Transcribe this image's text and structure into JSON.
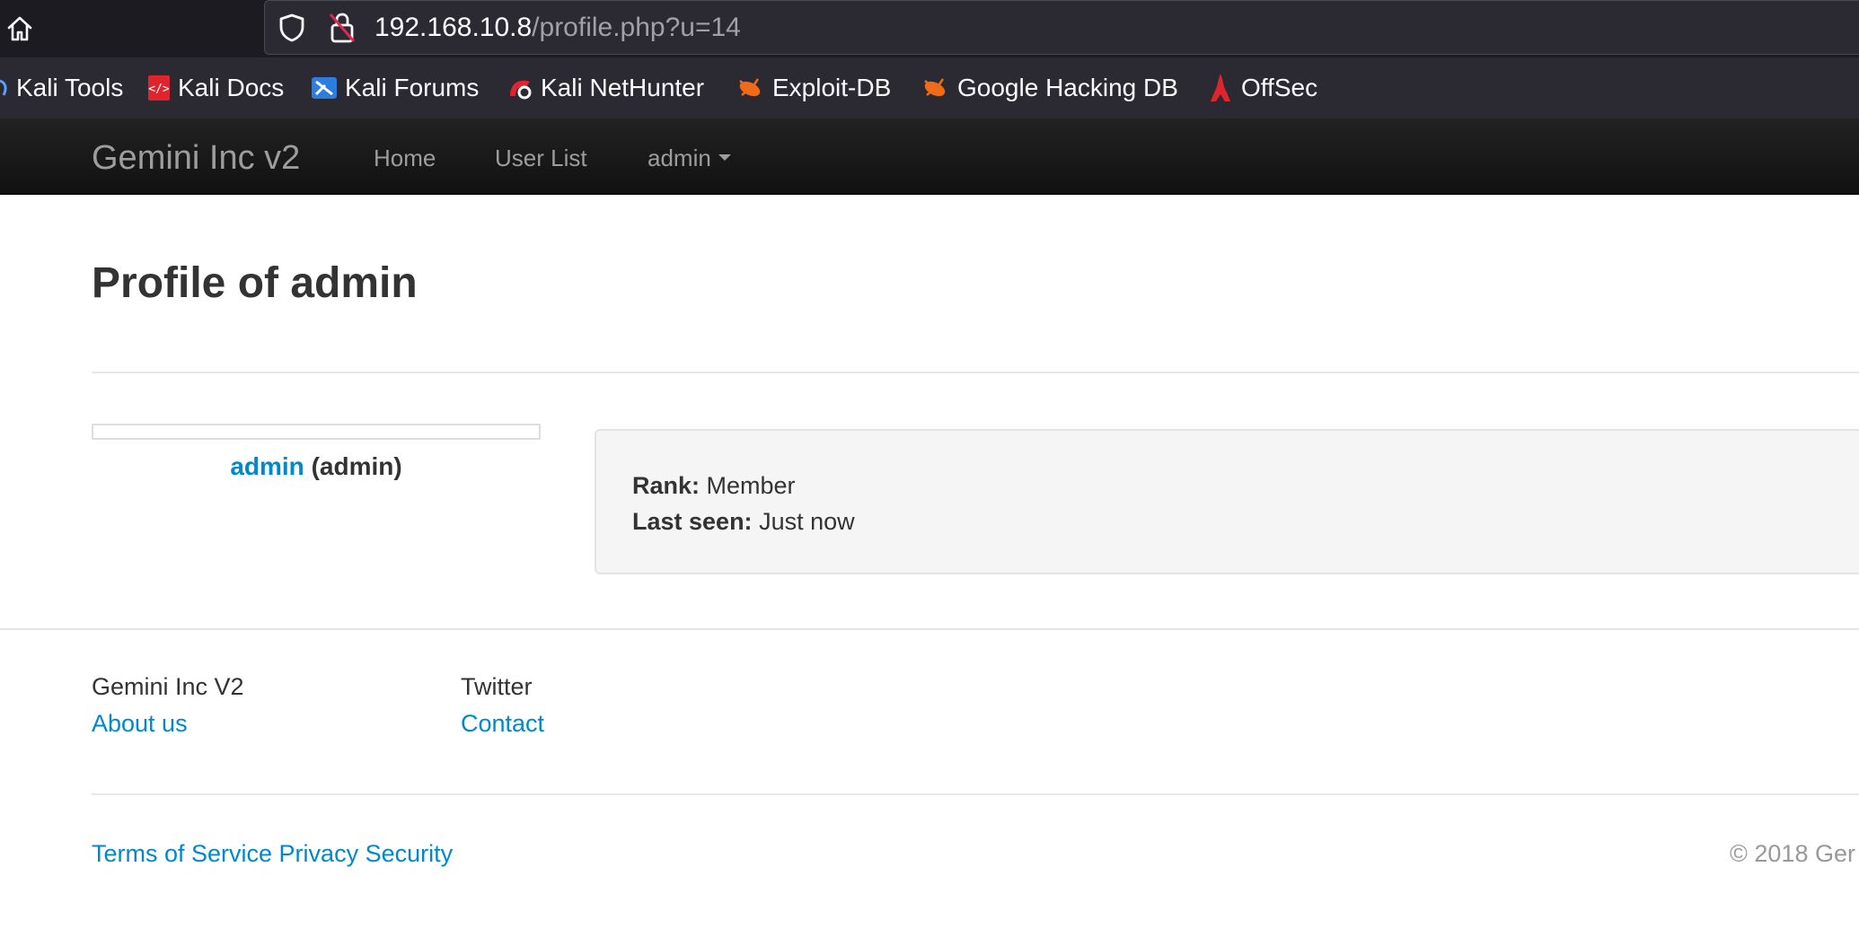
{
  "browser": {
    "url_host": "192.168.10.8",
    "url_path": "/profile.php?u=14",
    "bookmarks": [
      {
        "label": "Kali Tools",
        "icon": "kali-dragon-icon"
      },
      {
        "label": "Kali Docs",
        "icon": "kali-docs-icon"
      },
      {
        "label": "Kali Forums",
        "icon": "kali-forums-icon"
      },
      {
        "label": "Kali NetHunter",
        "icon": "kali-nethunter-icon"
      },
      {
        "label": "Exploit-DB",
        "icon": "exploit-db-icon"
      },
      {
        "label": "Google Hacking DB",
        "icon": "ghdb-icon"
      },
      {
        "label": "OffSec",
        "icon": "offsec-icon"
      }
    ]
  },
  "navbar": {
    "brand": "Gemini Inc v2",
    "links": [
      "Home",
      "User List"
    ],
    "user_menu": "admin"
  },
  "profile": {
    "title": "Profile of admin",
    "username": "admin",
    "role": "(admin)",
    "rank_label": "Rank:",
    "rank_value": "Member",
    "last_seen_label": "Last seen:",
    "last_seen_value": "Just now"
  },
  "footer": {
    "col1_heading": "Gemini Inc V2",
    "col1_link": "About us",
    "col2_heading": "Twitter",
    "col2_link": "Contact",
    "bottom_links": "Terms of Service Privacy Security",
    "copyright": "© 2018 Ger"
  },
  "colors": {
    "link": "#0088cc",
    "navbar_bg": "#1b1b1b",
    "browser_bg": "#1c1b22"
  }
}
